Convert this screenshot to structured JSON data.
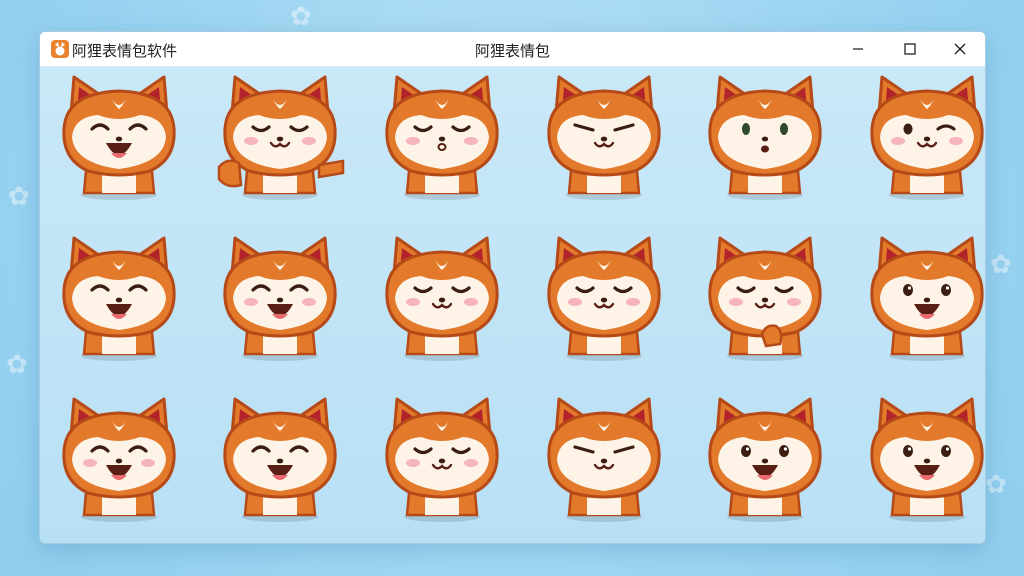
{
  "window": {
    "app_name": "阿狸表情包软件",
    "title": "阿狸表情包"
  },
  "controls": {
    "minimize_icon": "minimize-icon",
    "maximize_icon": "maximize-icon",
    "close_icon": "close-icon"
  },
  "colors": {
    "fur": "#e37a2b",
    "fur_dark": "#b54a18",
    "ear_inner": "#b2232b",
    "face": "#fdf4e7",
    "blush": "#f4a9b2",
    "background": "#a9dcf4"
  },
  "stickers": [
    {
      "name": "sticker-laughing",
      "expression": "laugh",
      "extra": "none"
    },
    {
      "name": "sticker-happy-wave",
      "expression": "happy",
      "extra": "arms"
    },
    {
      "name": "sticker-blush-whistle",
      "expression": "blush-whistle",
      "extra": "none"
    },
    {
      "name": "sticker-smug",
      "expression": "smug",
      "extra": "none"
    },
    {
      "name": "sticker-surprised",
      "expression": "surprised",
      "extra": "none"
    },
    {
      "name": "sticker-wink",
      "expression": "wink",
      "extra": "none"
    },
    {
      "name": "sticker-smile",
      "expression": "laugh",
      "extra": "none"
    },
    {
      "name": "sticker-squint-laugh",
      "expression": "squint",
      "extra": "none"
    },
    {
      "name": "sticker-content",
      "expression": "content",
      "extra": "none"
    },
    {
      "name": "sticker-blush-smile",
      "expression": "blush",
      "extra": "none"
    },
    {
      "name": "sticker-shy-wink",
      "expression": "blush",
      "extra": "paw"
    },
    {
      "name": "sticker-cheerful",
      "expression": "open",
      "extra": "none"
    },
    {
      "name": "sticker-big-laugh",
      "expression": "squint",
      "extra": "none"
    },
    {
      "name": "sticker-grin",
      "expression": "laugh",
      "extra": "none"
    },
    {
      "name": "sticker-peaceful",
      "expression": "content",
      "extra": "none"
    },
    {
      "name": "sticker-cheeky",
      "expression": "smug",
      "extra": "none"
    },
    {
      "name": "sticker-tongue",
      "expression": "open",
      "extra": "none"
    },
    {
      "name": "sticker-delighted",
      "expression": "open",
      "extra": "none"
    }
  ]
}
